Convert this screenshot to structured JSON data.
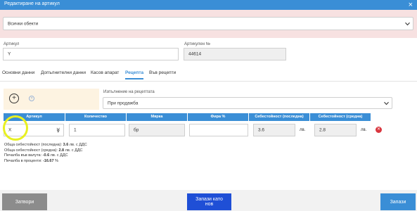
{
  "window": {
    "title": "Редактиране на артикул",
    "close_glyph": "×"
  },
  "object_select": {
    "value": "Всички обекти"
  },
  "article": {
    "label": "Артикул",
    "value": "Y"
  },
  "article_no": {
    "label": "Артикулен №",
    "value": "44614"
  },
  "tabs": [
    {
      "label": "Основни данни"
    },
    {
      "label": "Допълнителни данни"
    },
    {
      "label": "Касов апарат"
    },
    {
      "label": "Рецепта",
      "active": true
    },
    {
      "label": "Във рецепти"
    }
  ],
  "recipe": {
    "usage_label": "Изпълнение на рецептата",
    "usage_value": "При продажба",
    "add_icon": "plus-circle-icon",
    "help_glyph": "?"
  },
  "table": {
    "headers": [
      "Артикул",
      "Количество",
      "Мярка",
      "Фира %",
      "Себестойност (последна)",
      "Себестойност (средна)"
    ],
    "row": {
      "article": "X",
      "quantity": "1",
      "unit": "бр",
      "waste": "",
      "cost_last": "3.6",
      "cost_last_suffix": "лв.",
      "cost_avg": "2.8",
      "cost_avg_suffix": "лв."
    },
    "expand_glyph": "≫",
    "remove_glyph": "✕"
  },
  "summary": {
    "l1_prefix": "Обща себестойност (последна): ",
    "l1_value": "3.6",
    "l1_suffix": " лв. с ДДС",
    "l2_prefix": "Обща себестойност (средна): ",
    "l2_value": "2.8",
    "l2_suffix": " лв. с ДДС",
    "l3_prefix": "Печалба във валута: ",
    "l3_value": "-0.6",
    "l3_suffix": " лв. с ДДС",
    "l4_prefix": "Печалба в проценти: ",
    "l4_value": "-16.67",
    "l4_suffix": " %"
  },
  "buttons": {
    "close": "Затвори",
    "save_as_new": "Запази като нов",
    "save": "Запази"
  },
  "colors": {
    "primary": "#3a8ed6",
    "alert_bg": "#f7e1e1",
    "close_btn": "#8c8c8c",
    "save_new_btn": "#1f4fd6",
    "danger": "#d9363e",
    "highlight": "#e8f021"
  }
}
